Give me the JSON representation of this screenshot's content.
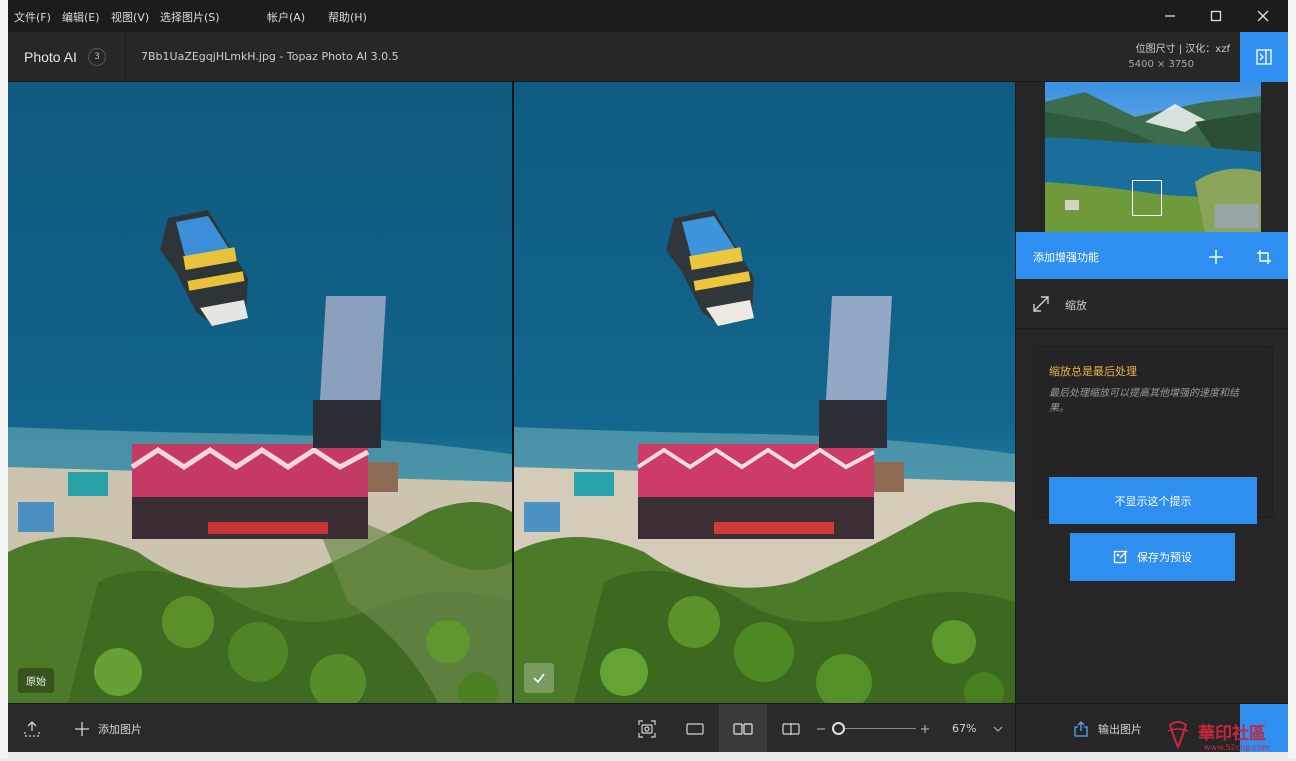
{
  "menu": {
    "file": "文件(F)",
    "edit": "编辑(E)",
    "view": "视图(V)",
    "select_image": "选择图片(S)",
    "account": "帐户(A)",
    "help": "帮助(H)"
  },
  "header": {
    "brand": "Photo AI",
    "badge_count": "3",
    "doc_title": "7Bb1UaZEgqjHLmkH.jpg - Topaz Photo AI 3.0.5",
    "size_label": "位图尺寸 | 汉化：xzf",
    "size_value": "5400 × 3750"
  },
  "viewer": {
    "original_tag": "原始"
  },
  "sidepanel": {
    "add_enhancement": "添加增强功能",
    "scale_label": "缩放",
    "tip_title": "缩放总是最后处理",
    "tip_body": "最后处理缩放可以提高其他增强的速度和结\n果。",
    "tip_button": "不显示这个提示",
    "save_preset": "保存为预设"
  },
  "bottombar": {
    "add_image": "添加图片",
    "zoom_value": "67%",
    "zoom_level": 0.05,
    "export": "输出图片"
  },
  "watermark": {
    "text": "華印社區",
    "url": "www.52cnp.com"
  },
  "colors": {
    "accent": "#2f8ff0",
    "tip_title": "#e8b64c",
    "background": "#232323"
  }
}
